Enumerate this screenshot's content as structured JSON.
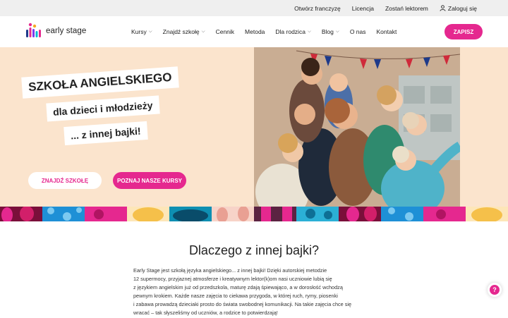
{
  "topbar": {
    "links": [
      "Otwórz franczyzę",
      "Licencja",
      "Zostań lektorem"
    ],
    "login_label": "Zaloguj się",
    "login_icon": "user-icon"
  },
  "nav": {
    "logo_text": "early stage",
    "items": [
      {
        "label": "Kursy",
        "has_dropdown": true
      },
      {
        "label": "Znajdź szkołę",
        "has_dropdown": true
      },
      {
        "label": "Cennik",
        "has_dropdown": false
      },
      {
        "label": "Metoda",
        "has_dropdown": false
      },
      {
        "label": "Dla rodzica",
        "has_dropdown": true
      },
      {
        "label": "Blog",
        "has_dropdown": true
      },
      {
        "label": "O nas",
        "has_dropdown": false
      },
      {
        "label": "Kontakt",
        "has_dropdown": false
      }
    ],
    "cta_label": "ZAPISZ"
  },
  "hero": {
    "line1": "SZKOŁA ANGIELSKIEGO",
    "line2": "dla dzieci i młodzieży",
    "line3": "... z innej bajki!",
    "button_find": "ZNAJDŹ SZKOŁĘ",
    "button_courses": "POZNAJ NASZE KURSY"
  },
  "section": {
    "title": "Dlaczego z innej bajki?",
    "lines": [
      "Early Stage jest szkołą języka angielskiego... z innej bajki! Dzięki autorskiej metodzie",
      "12 supermocy, przyjaznej atmosferze i kreatywnym lektor(k)om nasi uczniowie lubią się",
      "z językiem angielskim już od przedszkola, maturę zdają śpiewająco, a w dorosłość wchodzą",
      "pewnym krokiem. Każde nasze zajęcia to ciekawa przygoda, w której ruch, rymy, piosenki",
      "i zabawa prowadzą dzieciaki prosto do świata swobodnej komunikacji. Na takie zajęcia chce się",
      "wracać – tak słyszeliśmy od uczniów, a rodzice to potwierdzają!"
    ]
  },
  "help_icon": "question-icon",
  "colors": {
    "brand_pink": "#e5288f",
    "hero_bg": "#fbe4cd",
    "topbar_bg": "#efefef"
  }
}
